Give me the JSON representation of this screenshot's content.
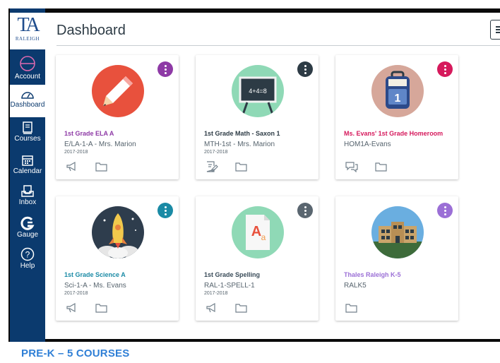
{
  "logo": {
    "mark": "TA",
    "text": "RALEIGH"
  },
  "nav": {
    "items": [
      {
        "label": "Account",
        "icon": "account-icon"
      },
      {
        "label": "Dashboard",
        "icon": "dashboard-icon",
        "active": true
      },
      {
        "label": "Courses",
        "icon": "courses-icon"
      },
      {
        "label": "Calendar",
        "icon": "calendar-icon"
      },
      {
        "label": "Inbox",
        "icon": "inbox-icon"
      },
      {
        "label": "Gauge",
        "icon": "gauge-icon"
      },
      {
        "label": "Help",
        "icon": "help-icon"
      }
    ]
  },
  "header": {
    "title": "Dashboard"
  },
  "cards": [
    {
      "name": "1st Grade ELA A",
      "code": "E/LA-1-A - Mrs. Marion",
      "term": "2017-2018",
      "color": "#8e3aa6",
      "circle": "#e8513d",
      "icon": "pencil-icon",
      "actions": [
        "announcements-icon",
        "files-icon"
      ]
    },
    {
      "name": "1st Grade Math - Saxon 1",
      "code": "MTH-1st - Mrs. Marion",
      "term": "2017-2018",
      "color": "#2d3b45",
      "circle": "#8fd9b6",
      "icon": "chalkboard-icon",
      "board_text": "4+4=8",
      "actions": [
        "assignments-icon",
        "files-icon"
      ]
    },
    {
      "name": "Ms. Evans' 1st Grade Homeroom",
      "code": "HOM1A-Evans",
      "term": "",
      "color": "#d6195c",
      "circle": "#d6a79a",
      "icon": "backpack-icon",
      "actions": [
        "discussions-icon",
        "files-icon"
      ]
    },
    {
      "name": "1st Grade Science A",
      "code": "Sci-1-A - Ms. Evans",
      "term": "2017-2018",
      "color": "#1a8aa5",
      "circle": "#2e3d4d",
      "icon": "rocket-icon",
      "actions": [
        "announcements-icon",
        "files-icon"
      ]
    },
    {
      "name": "1st Grade Spelling",
      "code": "RAL-1-SPELL-1",
      "term": "2017-2018",
      "color": "#394b58",
      "circle": "#8fd9b6",
      "icon": "spelling-icon",
      "actions": [
        "announcements-icon",
        "files-icon"
      ]
    },
    {
      "name": "Thales Raleigh K-5",
      "code": "RALK5",
      "term": "",
      "color": "#9b6fd6",
      "circle": "#6aaee0",
      "icon": "school-building-icon",
      "actions": [
        "files-icon"
      ]
    }
  ],
  "caption": "PRE-K – 5 COURSES"
}
